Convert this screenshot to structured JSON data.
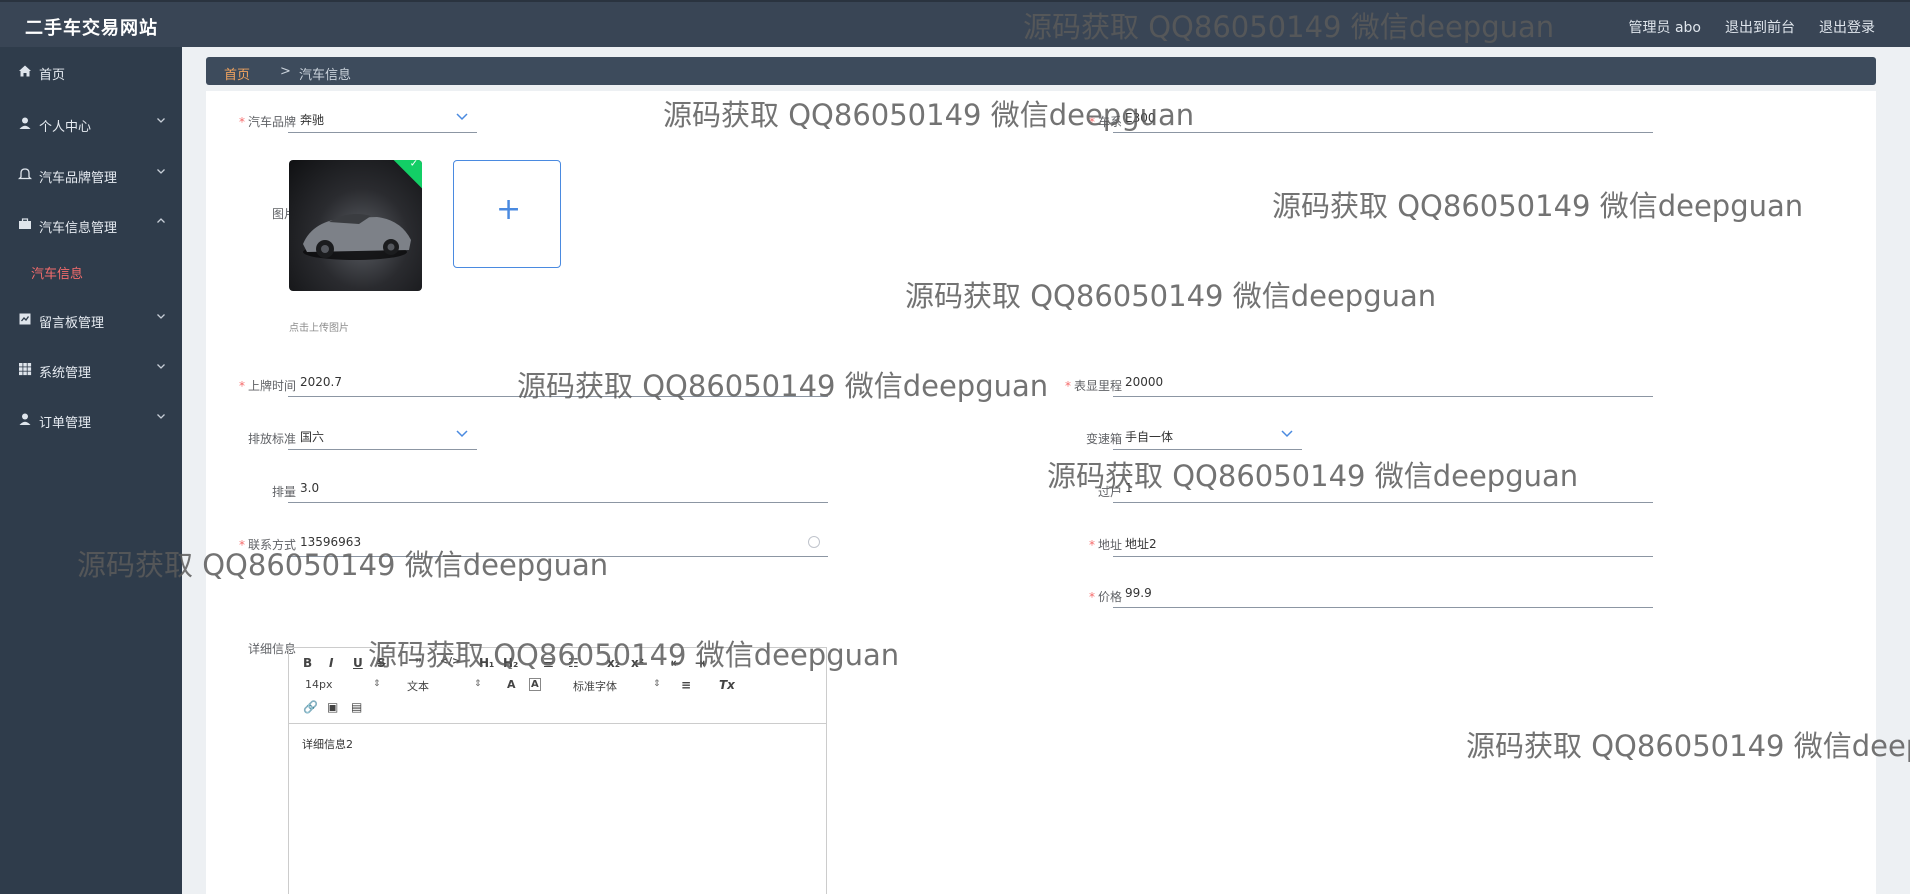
{
  "app": {
    "title": "二手车交易网站",
    "top_links": [
      "管理员 abo",
      "退出到前台",
      "退出登录"
    ]
  },
  "sidebar": {
    "items": [
      {
        "label": "首页",
        "icon": "home-icon"
      },
      {
        "label": "个人中心",
        "icon": "user-icon"
      },
      {
        "label": "汽车品牌管理",
        "icon": "bell-icon"
      },
      {
        "label": "汽车信息管理",
        "icon": "briefcase-icon"
      },
      {
        "label": "留言板管理",
        "icon": "message-icon"
      },
      {
        "label": "系统管理",
        "icon": "grid-icon"
      },
      {
        "label": "订单管理",
        "icon": "user-icon"
      }
    ],
    "active_sub": "汽车信息"
  },
  "breadcrumb": {
    "home": "首页",
    "separator": ">",
    "current": "汽车信息"
  },
  "form": {
    "brand_label": "汽车品牌",
    "brand_value": "奔驰",
    "series_label": "车系",
    "series_value": "E300",
    "image_label": "图片",
    "upload_hint": "点击上传图片",
    "reg_time_label": "上牌时间",
    "reg_time_value": "2020.7",
    "mileage_label": "表显里程",
    "mileage_value": "20000",
    "emission_label": "排放标准",
    "emission_value": "国六",
    "gearbox_label": "变速箱",
    "gearbox_value": "手自一体",
    "displacement_label": "排量",
    "displacement_value": "3.0",
    "transfer_label": "过户",
    "transfer_value": "1",
    "contact_label": "联系方式",
    "contact_value": "13596963",
    "address_label": "地址",
    "address_value": "地址2",
    "price_label": "价格",
    "price_value": "99.9",
    "detail_label": "详细信息"
  },
  "editor": {
    "font_size": "14px",
    "text_style": "文本",
    "font_family": "标准字体",
    "content": "详细信息2"
  },
  "watermark": "源码获取 QQ86050149 微信deepguan",
  "colors": {
    "topbar": "#394555",
    "sidebar": "#2f3c4b",
    "accent_red": "#f56c6c",
    "breadcrumb_home": "#f0a35e",
    "upload_border": "#4a8ae0"
  }
}
